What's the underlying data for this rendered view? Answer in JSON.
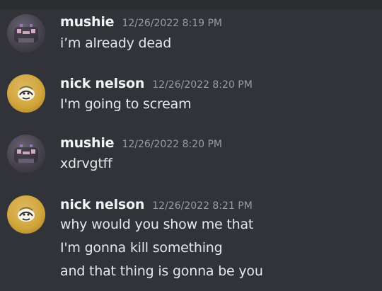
{
  "messages": [
    {
      "author": "mushie",
      "timestamp": "12/26/2022 8:19 PM",
      "lines": [
        "i’m already dead"
      ]
    },
    {
      "author": "nick nelson",
      "timestamp": "12/26/2022 8:20 PM",
      "lines": [
        "I'm going to scream"
      ]
    },
    {
      "author": "mushie",
      "timestamp": "12/26/2022 8:20 PM",
      "lines": [
        "xdrvgtff"
      ]
    },
    {
      "author": "nick nelson",
      "timestamp": "12/26/2022 8:21 PM",
      "lines": [
        "why would you show me that",
        "I'm gonna kill something",
        "and that thing is gonna be you"
      ]
    }
  ],
  "colors": {
    "background": "#313338",
    "username": "#f2f3f5",
    "timestamp": "#9a9ca3",
    "text": "#e6e7ea"
  },
  "icons": {
    "mushie_avatar": "avatar-mushie-icon",
    "nick_avatar": "avatar-nick-icon"
  }
}
